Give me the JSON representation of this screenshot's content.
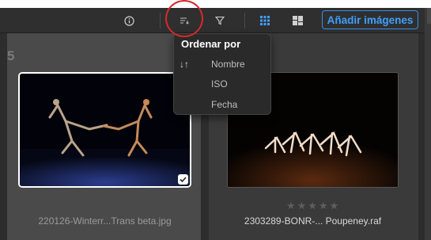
{
  "toolbar": {
    "icons": [
      "info-icon",
      "sort-icon",
      "filter-icon",
      "grid-view-icon",
      "mosaic-view-icon"
    ],
    "add_images_label": "Añadir imágenes",
    "accent_color": "#3fa0ff"
  },
  "gallery": {
    "count": "5",
    "items": [
      {
        "filename": "220126-Winterr...Trans beta.jpg",
        "selected": true
      },
      {
        "filename": "2303289-BONR-... Poupeney.raf",
        "selected": false,
        "rating": "★★★★★"
      }
    ]
  },
  "sort_menu": {
    "title": "Ordenar por",
    "sort_icon": "↓↑",
    "options": [
      "Nombre",
      "ISO",
      "Fecha"
    ]
  }
}
